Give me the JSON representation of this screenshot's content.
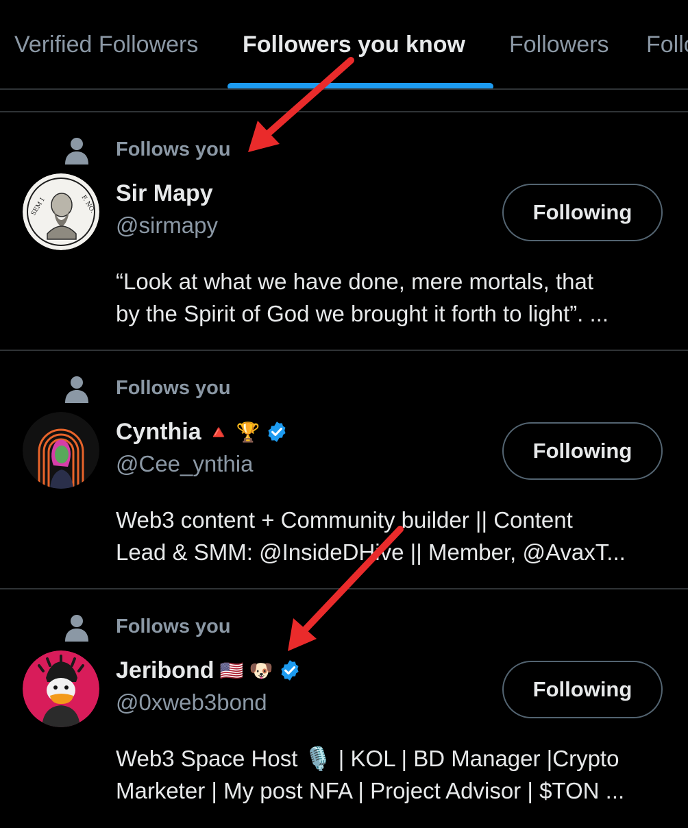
{
  "tabs": [
    {
      "label": "Verified Followers",
      "active": false
    },
    {
      "label": "Followers you know",
      "active": true
    },
    {
      "label": "Followers",
      "active": false
    },
    {
      "label": "Follo",
      "active": false
    }
  ],
  "users": [
    {
      "follows_label": "Follows you",
      "name": "Sir Mapy",
      "name_badges": [],
      "verified": false,
      "handle": "@sirmapy",
      "button_label": "Following",
      "bio_lines": [
        "“Look at what we have done, mere mortals, that",
        "by the Spirit of God we brought it forth to light”. ..."
      ],
      "avatar_text": {
        "left": "SEM I",
        "right": "F. NO."
      }
    },
    {
      "follows_label": "Follows you",
      "name": "Cynthia",
      "name_badges": [
        "🔺",
        "🏆"
      ],
      "verified": true,
      "handle": "@Cee_ynthia",
      "button_label": "Following",
      "bio_lines": [
        "Web3 content + Community builder || Content",
        "Lead & SMM:  @InsideDHive || Member, @AvaxT..."
      ]
    },
    {
      "follows_label": "Follows you",
      "name": "Jeribond",
      "name_badges": [
        "🇺🇸",
        "🐶"
      ],
      "verified": true,
      "handle": "@0xweb3bond",
      "button_label": "Following",
      "bio_lines": [
        "Web3 Space Host 🎙️ | KOL | BD Manager |Crypto",
        "Marketer | My post NFA | Project Advisor | $TON ..."
      ]
    }
  ],
  "colors": {
    "background": "#000000",
    "accent": "#1d9bf0",
    "annotation_arrow": "#ea2b2b"
  },
  "icons": {
    "follows": "person-icon",
    "verified": "verified-badge-icon"
  }
}
